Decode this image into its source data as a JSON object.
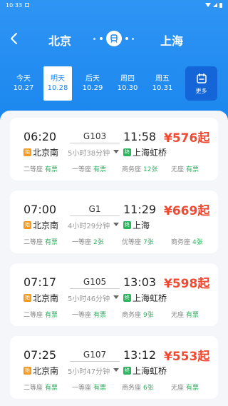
{
  "status_bar": {
    "time": "10:33"
  },
  "header": {
    "from_city": "北京",
    "to_city": "上海"
  },
  "date_tabs": [
    {
      "day": "今天",
      "date": "10.27",
      "active": false
    },
    {
      "day": "明天",
      "date": "10.28",
      "active": true
    },
    {
      "day": "后天",
      "date": "10.29",
      "active": false
    },
    {
      "day": "周四",
      "date": "10.30",
      "active": false
    },
    {
      "day": "周五",
      "date": "10.31",
      "active": false
    }
  ],
  "more_label": "更多",
  "colors": {
    "primary": "#1a86ee",
    "price": "#f04a32",
    "available": "#2bb55e",
    "start_badge": "#f59a1e",
    "end_badge": "#2bb55e"
  },
  "trains": [
    {
      "departure_time": "06:20",
      "arrival_time": "11:58",
      "train_no": "G103",
      "duration": "5小时38分钟",
      "price": "¥576起",
      "from_station": "北京南",
      "to_station": "上海虹桥",
      "start_badge": "始",
      "end_badge": "终",
      "seats": [
        {
          "class": "二等座",
          "availability": "有票"
        },
        {
          "class": "一等座",
          "availability": "有票"
        },
        {
          "class": "商务座",
          "availability": "12张"
        },
        {
          "class": "无座",
          "availability": "有票"
        }
      ]
    },
    {
      "departure_time": "07:00",
      "arrival_time": "11:29",
      "train_no": "G1",
      "duration": "4小时29分钟",
      "price": "¥669起",
      "from_station": "北京南",
      "to_station": "上海",
      "start_badge": "始",
      "end_badge": "终",
      "seats": [
        {
          "class": "二等座",
          "availability": "有票"
        },
        {
          "class": "一等座",
          "availability": "2张"
        },
        {
          "class": "优等座",
          "availability": "7张"
        },
        {
          "class": "商务座",
          "availability": "4张"
        }
      ]
    },
    {
      "departure_time": "07:17",
      "arrival_time": "13:03",
      "train_no": "G105",
      "duration": "5小时46分钟",
      "price": "¥598起",
      "from_station": "北京南",
      "to_station": "上海虹桥",
      "start_badge": "始",
      "end_badge": "终",
      "seats": [
        {
          "class": "二等座",
          "availability": "有票"
        },
        {
          "class": "一等座",
          "availability": "有票"
        },
        {
          "class": "商务座",
          "availability": "9张"
        },
        {
          "class": "无座",
          "availability": "有票"
        }
      ]
    },
    {
      "departure_time": "07:25",
      "arrival_time": "13:12",
      "train_no": "G107",
      "duration": "5小时47分钟",
      "price": "¥553起",
      "from_station": "北京南",
      "to_station": "上海虹桥",
      "start_badge": "始",
      "end_badge": "终",
      "seats": [
        {
          "class": "二等座",
          "availability": "有票"
        },
        {
          "class": "一等座",
          "availability": "有票"
        },
        {
          "class": "商务座",
          "availability": "6张"
        },
        {
          "class": "无座",
          "availability": "有票"
        }
      ]
    }
  ]
}
